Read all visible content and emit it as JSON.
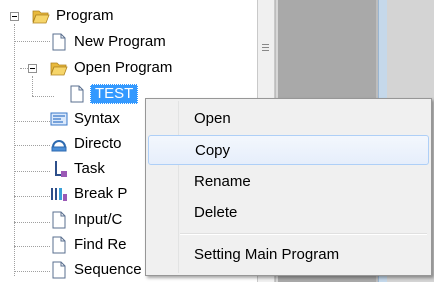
{
  "tree": {
    "program": "Program",
    "new_program": "New Program",
    "open_program": "Open Program",
    "test": "TEST",
    "syntax": "Syntax",
    "directory": "Directo",
    "task": "Task",
    "break": "Break P",
    "input": "Input/C",
    "find": "Find Re",
    "sequence": "Sequence Execution"
  },
  "context_menu": {
    "open": "Open",
    "copy": "Copy",
    "rename": "Rename",
    "delete": "Delete",
    "setting_main": "Setting Main Program"
  }
}
